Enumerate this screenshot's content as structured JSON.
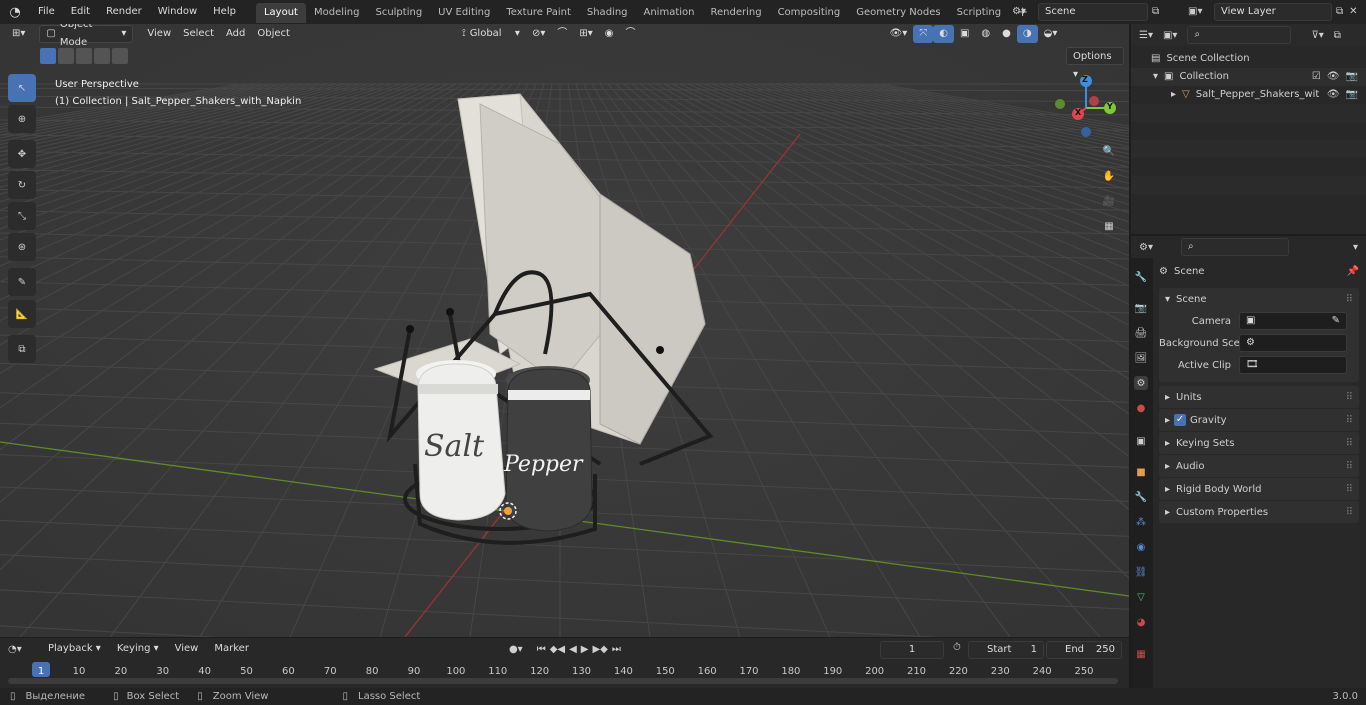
{
  "topbar": {
    "menus": [
      "File",
      "Edit",
      "Render",
      "Window",
      "Help"
    ],
    "workspaces": [
      "Layout",
      "Modeling",
      "Sculpting",
      "UV Editing",
      "Texture Paint",
      "Shading",
      "Animation",
      "Rendering",
      "Compositing",
      "Geometry Nodes",
      "Scripting"
    ],
    "active_workspace": "Layout",
    "add_tab": "+",
    "scene": "Scene",
    "view_layer": "View Layer"
  },
  "viewport": {
    "mode": "Object Mode",
    "menus": [
      "View",
      "Select",
      "Add",
      "Object"
    ],
    "orientation": "Global",
    "options": "Options",
    "overlay_line1": "User Perspective",
    "overlay_line2": "(1) Collection | Salt_Pepper_Shakers_with_Napkin",
    "gizmo_axes": [
      "Z",
      "Y",
      "X"
    ],
    "salt_label": "Salt",
    "pepper_label": "Pepper"
  },
  "outliner": {
    "root": "Scene Collection",
    "collection": "Collection",
    "object": "Salt_Pepper_Shakers_wit"
  },
  "properties": {
    "header": "Scene",
    "panel_title": "Scene",
    "camera_label": "Camera",
    "background_label": "Background Sce...",
    "active_clip_label": "Active Clip",
    "panels": [
      "Units",
      "Gravity",
      "Keying Sets",
      "Audio",
      "Rigid Body World",
      "Custom Properties"
    ],
    "gravity_checked": true
  },
  "timeline": {
    "menus": [
      "Playback",
      "Keying",
      "View",
      "Marker"
    ],
    "current_frame": "1",
    "start_label": "Start",
    "start": "1",
    "end_label": "End",
    "end": "250",
    "ticks": [
      "1",
      "10",
      "20",
      "30",
      "40",
      "50",
      "60",
      "70",
      "80",
      "90",
      "100",
      "110",
      "120",
      "130",
      "140",
      "150",
      "160",
      "170",
      "180",
      "190",
      "200",
      "210",
      "220",
      "230",
      "240",
      "250"
    ]
  },
  "statusbar": {
    "items": [
      "Выделение",
      "Box Select",
      "Zoom View",
      "Lasso Select"
    ],
    "version": "3.0.0"
  },
  "colors": {
    "accent": "#4772b3",
    "x_axis": "#e0444f",
    "y_axis": "#7ec83a",
    "z_axis": "#3f8fe0"
  }
}
